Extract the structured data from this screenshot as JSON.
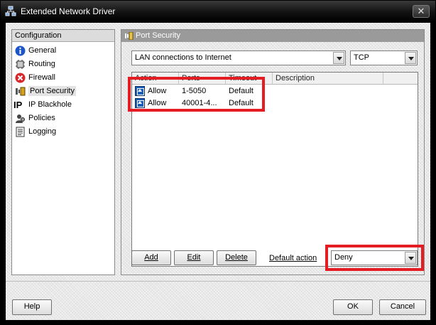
{
  "window": {
    "title": "Extended Network Driver",
    "close_glyph": "✕"
  },
  "nav": {
    "header": "Configuration",
    "items": [
      {
        "label": "General",
        "icon": "info-icon"
      },
      {
        "label": "Routing",
        "icon": "routing-icon"
      },
      {
        "label": "Firewall",
        "icon": "firewall-icon"
      },
      {
        "label": "Port Security",
        "icon": "port-security-icon",
        "selected": true
      },
      {
        "label": "IP Blackhole",
        "icon": "ip-icon",
        "glyph": "IP"
      },
      {
        "label": "Policies",
        "icon": "policies-icon"
      },
      {
        "label": "Logging",
        "icon": "logging-icon"
      }
    ]
  },
  "content": {
    "header": "Port Security",
    "connection_select": "LAN connections to Internet",
    "protocol_select": "TCP",
    "columns": [
      "Action",
      "Ports",
      "Timeout",
      "Description"
    ],
    "rows": [
      {
        "action": "Allow",
        "ports": "1-5050",
        "timeout": "Default",
        "description": ""
      },
      {
        "action": "Allow",
        "ports": "40001-4...",
        "timeout": "Default",
        "description": ""
      }
    ],
    "add_label": "Add",
    "edit_label": "Edit",
    "delete_label": "Delete",
    "default_action_label": "Default action",
    "default_action_value": "Deny"
  },
  "footer": {
    "help_label": "Help",
    "ok_label": "OK",
    "cancel_label": "Cancel"
  },
  "colors": {
    "highlight": "#e41c23",
    "title_bar": "#000000",
    "allow_icon": "#1a5fb4"
  }
}
